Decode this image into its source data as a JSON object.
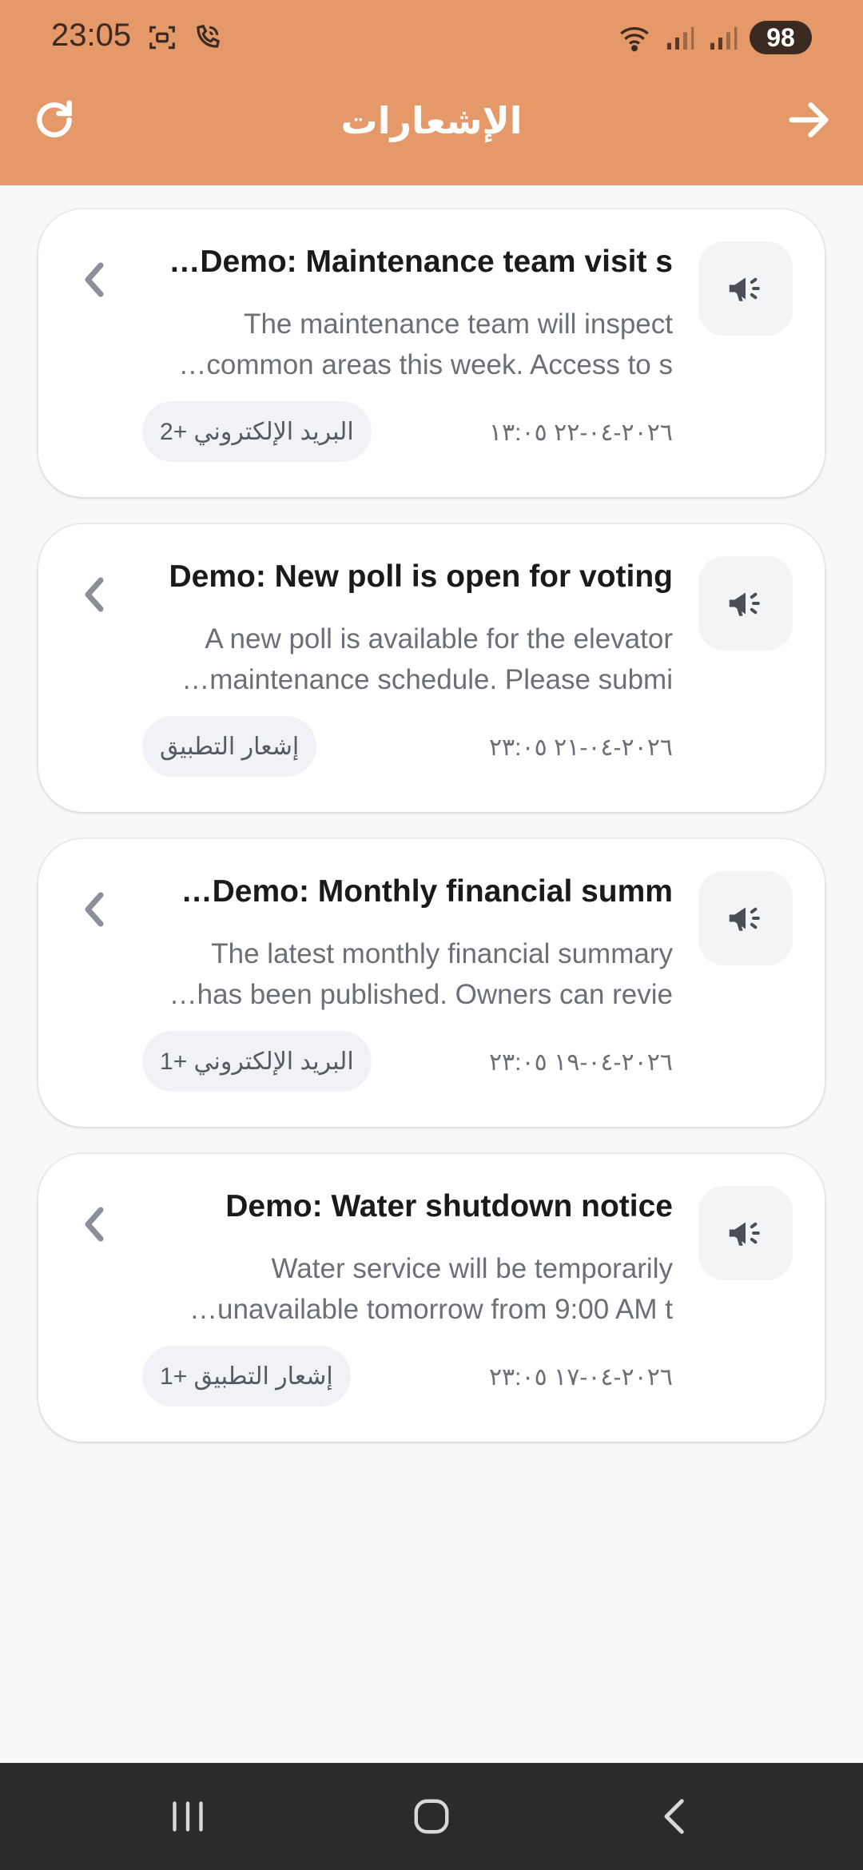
{
  "status_bar": {
    "time": "23:05",
    "battery": "98"
  },
  "header": {
    "title": "الإشعارات"
  },
  "notifications": [
    {
      "title": "…Demo: Maintenance team visit s",
      "body_line1": "The maintenance team will inspect",
      "body_line2": "…common areas this week. Access to s",
      "date": "٢٠٢٦-٠٤-٢٢ ١٣:٠٥",
      "channel": "البريد الإلكتروني +2"
    },
    {
      "title": "Demo: New poll is open for voting",
      "body_line1": "A new poll is available for the elevator",
      "body_line2": "…maintenance schedule. Please submi",
      "date": "٢٠٢٦-٠٤-٢١ ٢٣:٠٥",
      "channel": "إشعار التطبيق"
    },
    {
      "title": "…Demo: Monthly financial summ",
      "body_line1": "The latest monthly financial summary",
      "body_line2": "…has been published. Owners can revie",
      "date": "٢٠٢٦-٠٤-١٩ ٢٣:٠٥",
      "channel": "البريد الإلكتروني +1"
    },
    {
      "title": "Demo: Water shutdown notice",
      "body_line1": "Water service will be temporarily",
      "body_line2": "…unavailable tomorrow from 9:00 AM t",
      "date": "٢٠٢٦-٠٤-١٧ ٢٣:٠٥",
      "channel": "إشعار التطبيق +1"
    }
  ],
  "icons": {
    "refresh": "refresh-icon",
    "back": "arrow-right-icon",
    "card": "megaphone-icon",
    "open": "chevron-left-icon"
  },
  "colors": {
    "accent": "#e59868",
    "background": "#f7f8fa",
    "nav_bar": "#2b2b2d"
  }
}
